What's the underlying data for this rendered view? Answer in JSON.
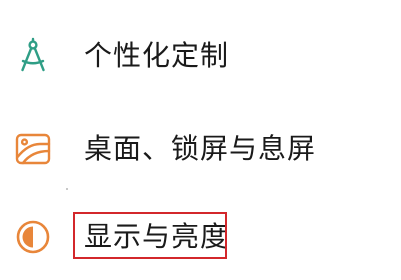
{
  "menu": {
    "items": [
      {
        "label": "个性化定制",
        "icon": "compass-icon",
        "icon_color": "#2f9e86"
      },
      {
        "label": "桌面、锁屏与息屏",
        "icon": "wallpaper-icon",
        "icon_color": "#e8863a"
      },
      {
        "label": "显示与亮度",
        "icon": "brightness-icon",
        "icon_color": "#e8863a",
        "highlighted": true
      }
    ]
  },
  "colors": {
    "text": "#1a1a1a",
    "highlight_border": "#d3272b",
    "background": "#ffffff"
  }
}
